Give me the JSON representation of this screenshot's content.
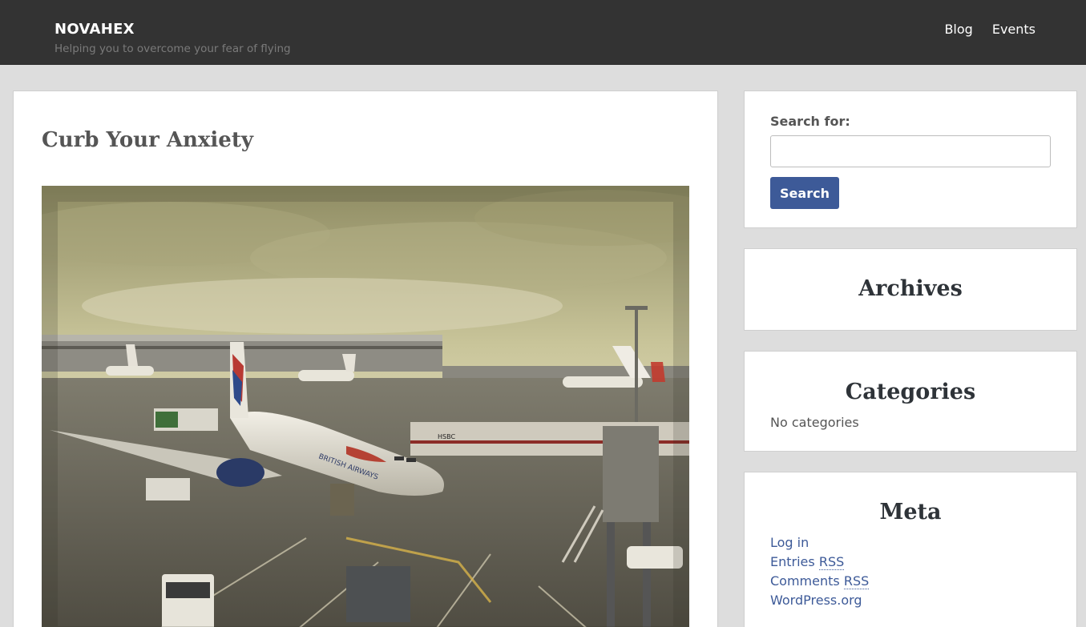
{
  "header": {
    "site_title": "NOVAHEX",
    "site_description": "Helping you to overcome your fear of flying",
    "nav": [
      {
        "label": "Blog"
      },
      {
        "label": "Events"
      }
    ]
  },
  "post": {
    "title": "Curb Your Anxiety",
    "image": {
      "subject": "airliner-at-airport-gate-photo",
      "tail_text": "HSBC",
      "fuselage_text": "BRITISH AIRWAYS"
    }
  },
  "sidebar": {
    "search": {
      "label": "Search for:",
      "input_value": "",
      "button_label": "Search"
    },
    "archives": {
      "title": "Archives"
    },
    "categories": {
      "title": "Categories",
      "empty_text": "No categories"
    },
    "meta": {
      "title": "Meta",
      "links": [
        {
          "label": "Log in"
        },
        {
          "label": "Entries",
          "abbr": "RSS"
        },
        {
          "label": "Comments",
          "abbr": "RSS"
        },
        {
          "label": "WordPress.org"
        }
      ]
    }
  },
  "colors": {
    "header_bg": "#333333",
    "page_bg": "#dddddd",
    "accent": "#3d5a98",
    "heading": "#2e3338"
  }
}
